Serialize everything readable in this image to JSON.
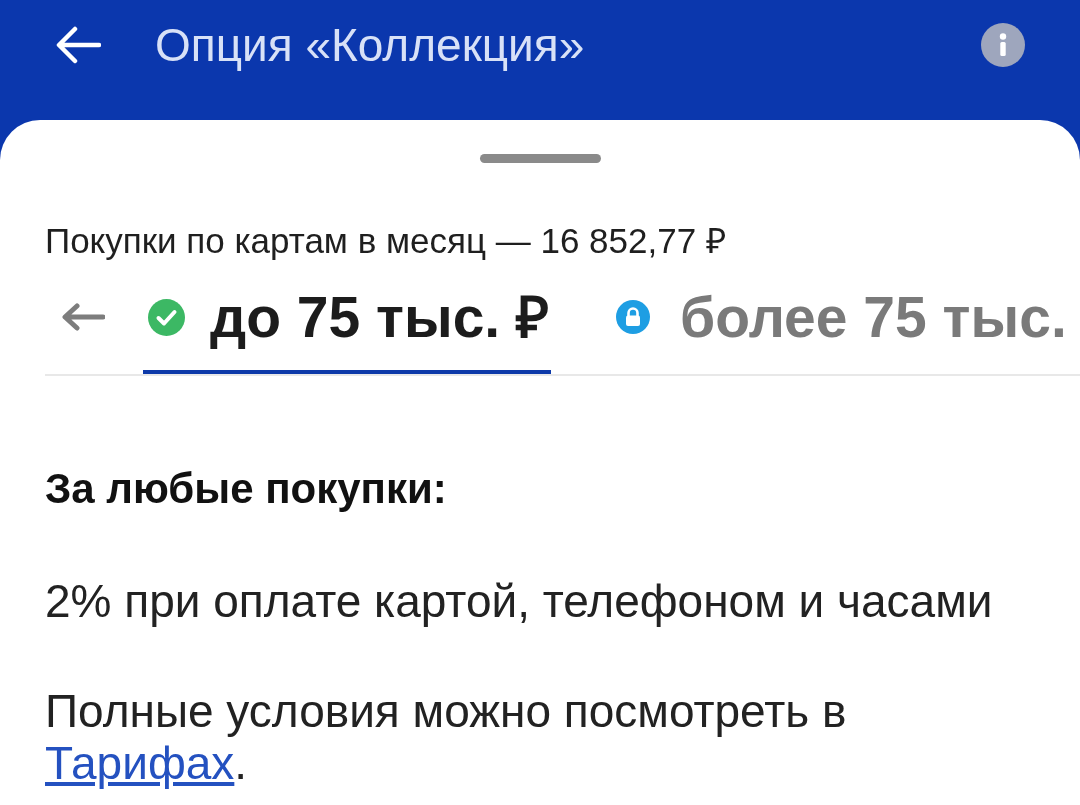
{
  "header": {
    "title": "Опция «Коллекция»"
  },
  "sheet": {
    "summary": "Покупки по картам в месяц — 16 852,77 ₽",
    "tabs": [
      {
        "label": "до 75 тыс. ₽",
        "selected": true,
        "kind": "available"
      },
      {
        "label": "более 75 тыс.",
        "selected": false,
        "kind": "locked"
      }
    ],
    "content": {
      "heading": "За любые покупки:",
      "benefit": "2% при оплате картой, телефоном и часами",
      "terms": {
        "before": "Полные условия можно посмотреть в",
        "link": "Тарифах",
        "after": "."
      }
    }
  }
}
